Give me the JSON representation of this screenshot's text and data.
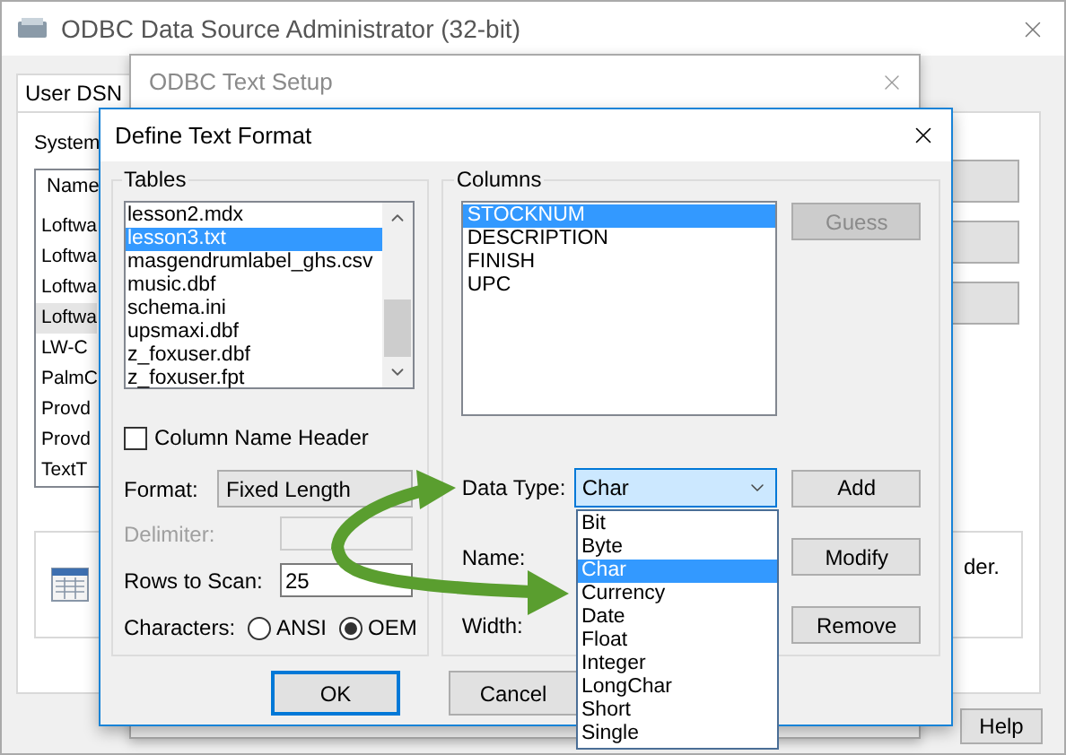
{
  "admin_window": {
    "title": "ODBC Data Source Administrator (32-bit)",
    "tabs": [
      {
        "label": "User DSN",
        "selected": true
      }
    ],
    "group_label": "System",
    "list_header": "Name",
    "list_items": [
      {
        "label": "Loftwa",
        "selected": false
      },
      {
        "label": "Loftwa",
        "selected": false
      },
      {
        "label": "Loftwa",
        "selected": false
      },
      {
        "label": "Loftwa",
        "selected": true
      },
      {
        "label": "LW-C",
        "selected": false
      },
      {
        "label": "PalmC",
        "selected": false
      },
      {
        "label": "Provd",
        "selected": false
      },
      {
        "label": "Provd",
        "selected": false
      },
      {
        "label": "TextT",
        "selected": false
      }
    ],
    "note_text": "der.",
    "help_button": "Help"
  },
  "text_setup_window": {
    "title": "ODBC Text Setup"
  },
  "define_text_format": {
    "title": "Define Text Format",
    "tables": {
      "label": "Tables",
      "items": [
        {
          "label": "lesson2.mdx",
          "selected": false
        },
        {
          "label": "lesson3.txt",
          "selected": true
        },
        {
          "label": "masgendrumlabel_ghs.csv",
          "selected": false
        },
        {
          "label": "music.dbf",
          "selected": false
        },
        {
          "label": "schema.ini",
          "selected": false
        },
        {
          "label": "upsmaxi.dbf",
          "selected": false
        },
        {
          "label": "z_foxuser.dbf",
          "selected": false
        },
        {
          "label": "z_foxuser.fpt",
          "selected": false
        }
      ]
    },
    "column_name_header": {
      "label": "Column Name Header",
      "checked": false
    },
    "format": {
      "label": "Format:",
      "value": "Fixed Length"
    },
    "delimiter": {
      "label": "Delimiter:",
      "disabled": true
    },
    "rows_to_scan": {
      "label": "Rows to Scan:",
      "value": "25"
    },
    "characters": {
      "label": "Characters:",
      "options": [
        {
          "label": "ANSI",
          "selected": false
        },
        {
          "label": "OEM",
          "selected": true
        }
      ]
    },
    "columns": {
      "label": "Columns",
      "items": [
        {
          "label": "STOCKNUM",
          "selected": true
        },
        {
          "label": "DESCRIPTION",
          "selected": false
        },
        {
          "label": "FINISH",
          "selected": false
        },
        {
          "label": "UPC",
          "selected": false
        }
      ]
    },
    "guess_button": {
      "label": "Guess",
      "disabled": true
    },
    "data_type": {
      "label": "Data Type:",
      "value": "Char",
      "button": "Add",
      "options": [
        {
          "label": "Bit",
          "selected": false
        },
        {
          "label": "Byte",
          "selected": false
        },
        {
          "label": "Char",
          "selected": true
        },
        {
          "label": "Currency",
          "selected": false
        },
        {
          "label": "Date",
          "selected": false
        },
        {
          "label": "Float",
          "selected": false
        },
        {
          "label": "Integer",
          "selected": false
        },
        {
          "label": "LongChar",
          "selected": false
        },
        {
          "label": "Short",
          "selected": false
        },
        {
          "label": "Single",
          "selected": false
        }
      ]
    },
    "name": {
      "label": "Name:",
      "button": "Modify"
    },
    "width": {
      "label": "Width:",
      "button": "Remove"
    },
    "buttons": [
      {
        "label": "OK",
        "default": true
      },
      {
        "label": "Cancel",
        "default": false
      }
    ]
  }
}
